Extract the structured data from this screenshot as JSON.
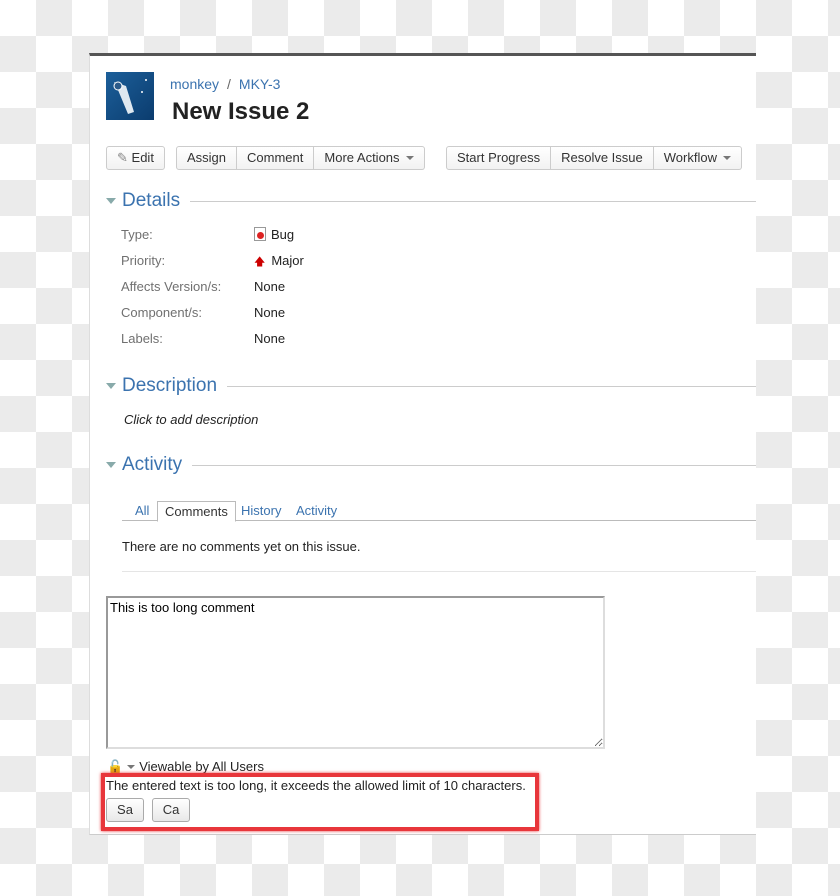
{
  "breadcrumb": {
    "project": "monkey",
    "separator": "/",
    "issue_key": "MKY-3"
  },
  "title": "New Issue 2",
  "toolbar": {
    "edit": "Edit",
    "assign": "Assign",
    "comment": "Comment",
    "more_actions": "More Actions",
    "start_progress": "Start Progress",
    "resolve_issue": "Resolve Issue",
    "workflow": "Workflow"
  },
  "details": {
    "heading": "Details",
    "fields": [
      {
        "label": "Type:",
        "value": "Bug",
        "icon": "bug-icon"
      },
      {
        "label": "Priority:",
        "value": "Major",
        "icon": "priority-major-icon"
      },
      {
        "label": "Affects Version/s:",
        "value": "None"
      },
      {
        "label": "Component/s:",
        "value": "None"
      },
      {
        "label": "Labels:",
        "value": "None"
      }
    ]
  },
  "description": {
    "heading": "Description",
    "placeholder": "Click to add description"
  },
  "activity": {
    "heading": "Activity",
    "tabs": [
      "All",
      "Comments",
      "History",
      "Activity"
    ],
    "active_tab": "Comments",
    "empty": "There are no comments yet on this issue."
  },
  "comment_form": {
    "value": "This is too long comment",
    "visibility": "Viewable by All Users",
    "error": "The entered text is too long, it exceeds the allowed limit of 10 characters.",
    "save": "Sa",
    "cancel": "Ca"
  },
  "colors": {
    "link": "#3b73af",
    "error_outline": "#e8363b"
  }
}
